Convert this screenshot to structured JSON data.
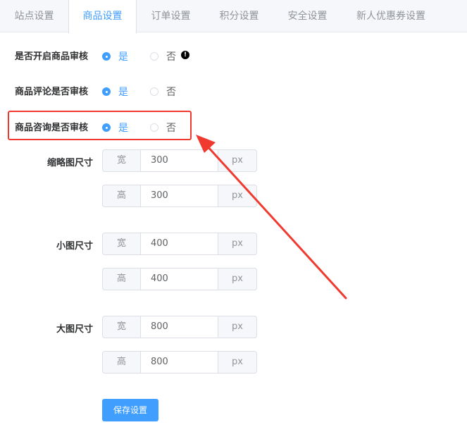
{
  "tabs": [
    "站点设置",
    "商品设置",
    "订单设置",
    "积分设置",
    "安全设置",
    "新人优惠券设置"
  ],
  "settings": [
    {
      "label": "是否开启商品审核",
      "yes": "是",
      "no": "否",
      "selected": "yes"
    },
    {
      "label": "商品评论是否审核",
      "yes": "是",
      "no": "否",
      "selected": "yes"
    },
    {
      "label": "商品咨询是否审核",
      "yes": "是",
      "no": "否",
      "selected": "yes"
    }
  ],
  "warn_glyph": "!",
  "sizes": [
    {
      "label": "缩略图尺寸",
      "width_prefix": "宽",
      "width": "300",
      "height_prefix": "高",
      "height": "300",
      "unit": "px"
    },
    {
      "label": "小图尺寸",
      "width_prefix": "宽",
      "width": "400",
      "height_prefix": "高",
      "height": "400",
      "unit": "px"
    },
    {
      "label": "大图尺寸",
      "width_prefix": "宽",
      "width": "800",
      "height_prefix": "高",
      "height": "800",
      "unit": "px"
    }
  ],
  "save_button": "保存设置",
  "colors": {
    "accent": "#409eff",
    "annotation": "#f03a2f"
  }
}
